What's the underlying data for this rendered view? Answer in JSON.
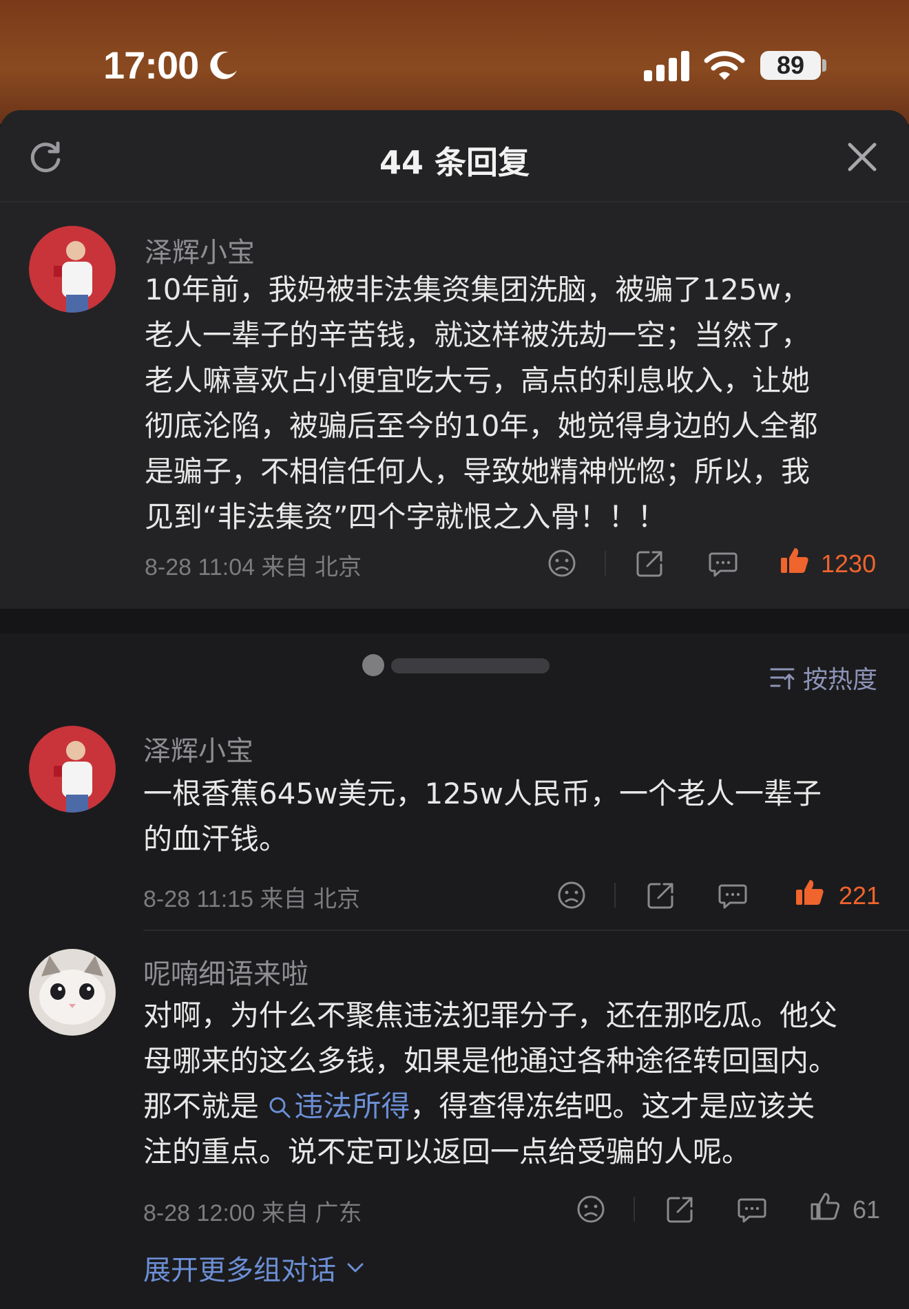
{
  "status_bar": {
    "time": "17:00",
    "battery": "89"
  },
  "sheet": {
    "title": "44 条回复"
  },
  "root_comment": {
    "username": "泽辉小宝",
    "text": "10年前，我妈被非法集资集团洗脑，被骗了125w，\n老人一辈子的辛苦钱，就这样被洗劫一空；当然了，\n老人嘛喜欢占小便宜吃大亏，高点的利息收入，让她\n彻底沦陷，被骗后至今的10年，她觉得身边的人全都\n是骗子，不相信任何人，导致她精神恍惚；所以，我\n见到“非法集资”四个字就恨之入骨！！！",
    "meta": "8-28 11:04 来自 北京",
    "likes": "1230"
  },
  "sort_label": "按热度",
  "replies": [
    {
      "username": "泽辉小宝",
      "text": "一根香蕉645w美元，125w人民币，一个老人一辈子\n的血汗钱。",
      "meta": "8-28 11:15 来自 北京",
      "likes": "221"
    },
    {
      "username": "呢喃细语来啦",
      "text_before": "对啊，为什么不聚焦违法犯罪分子，还在那吃瓜。他父\n母哪来的这么多钱，如果是他通过各种途径转回国内。\n那不就是 ",
      "link": "违法所得",
      "text_after": "，得查得冻结吧。这才是应该关\n注的重点。说不定可以返回一点给受骗的人呢。",
      "meta": "8-28 12:00 来自 广东",
      "likes": "61"
    }
  ],
  "expand_label": "展开更多组对话",
  "colors": {
    "like_active": "#f0642d",
    "link": "#6c8fd6",
    "background": "#1b1b1d"
  },
  "icons": [
    "moon-icon",
    "signal-icon",
    "wifi-icon",
    "refresh-icon",
    "close-icon",
    "dislike-icon",
    "share-icon",
    "comment-icon",
    "like-icon",
    "sort-icon",
    "search-icon",
    "chevron-down-icon"
  ]
}
